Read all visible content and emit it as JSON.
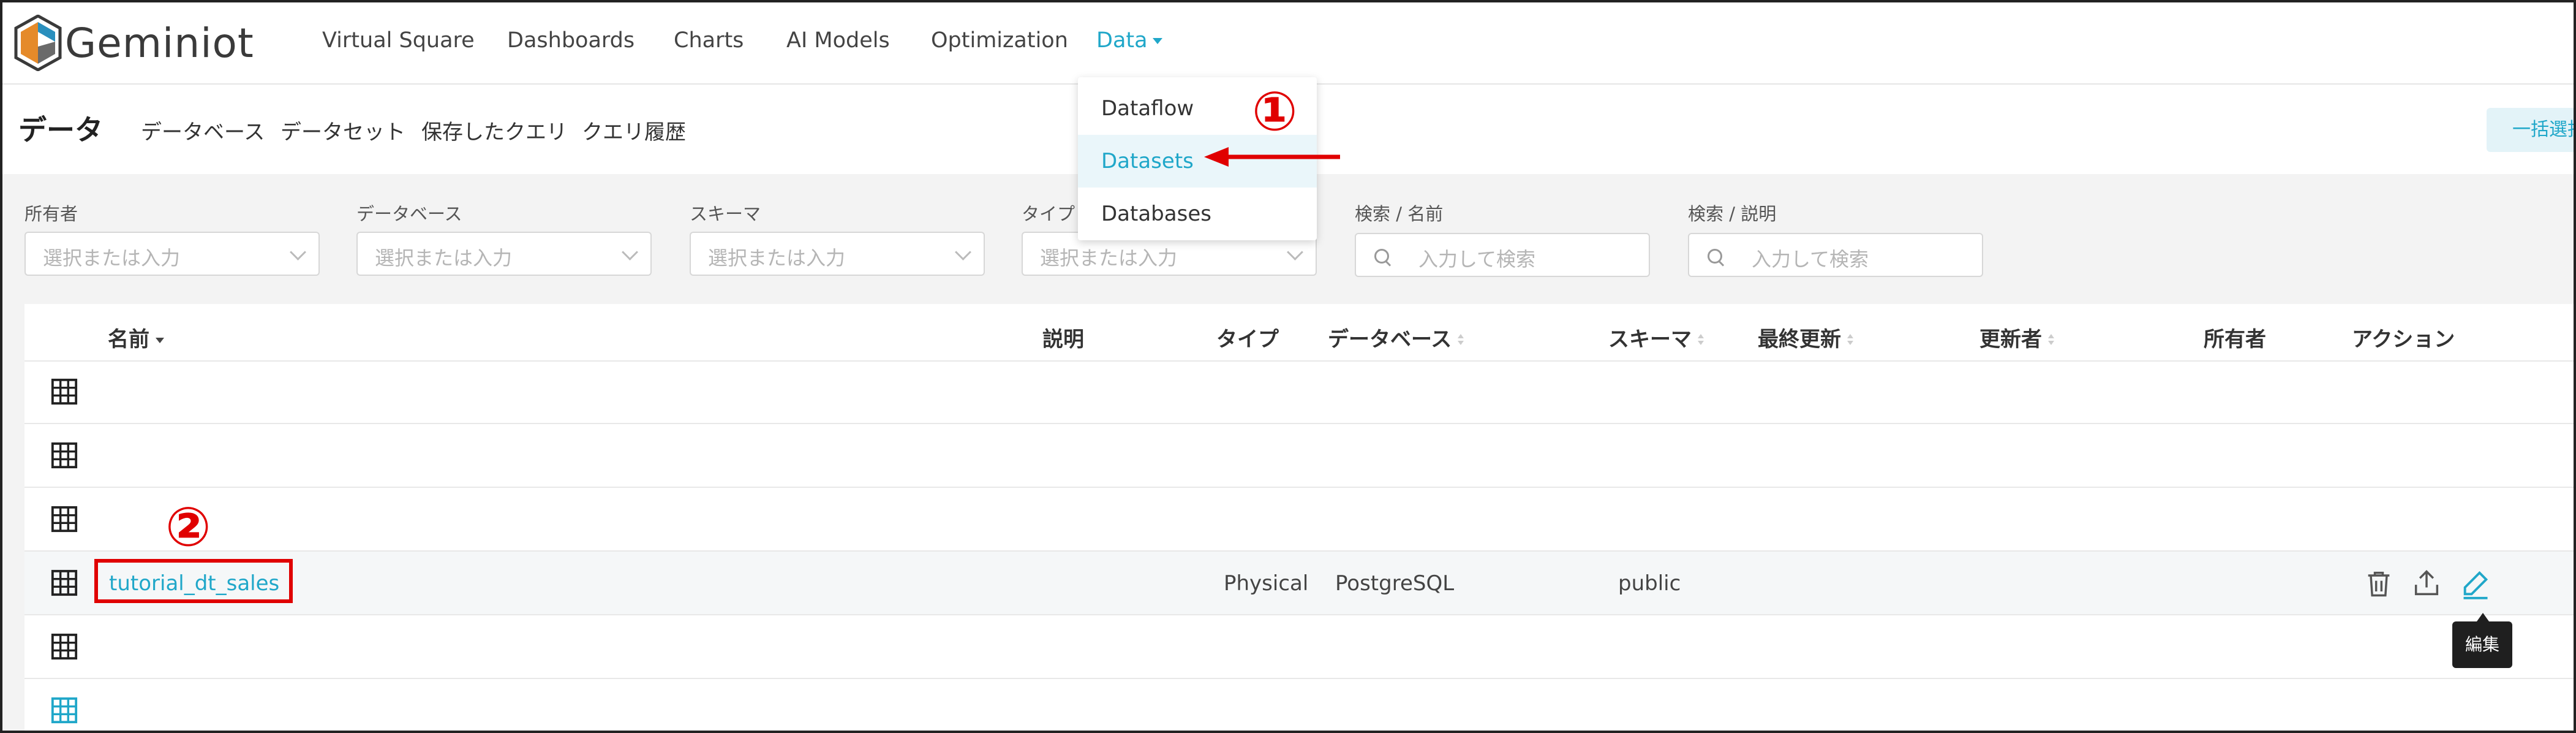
{
  "app": {
    "name": "Geminiot"
  },
  "nav": {
    "items": [
      {
        "label": "Virtual Square"
      },
      {
        "label": "Dashboards"
      },
      {
        "label": "Charts"
      },
      {
        "label": "AI Models"
      },
      {
        "label": "Optimization"
      },
      {
        "label": "Data"
      }
    ],
    "active": "Data"
  },
  "data_menu": {
    "items": [
      {
        "label": "Dataflow"
      },
      {
        "label": "Datasets"
      },
      {
        "label": "Databases"
      }
    ],
    "selected": "Datasets"
  },
  "page": {
    "title": "データ",
    "tabs": [
      {
        "label": "データベース"
      },
      {
        "label": "データセット"
      },
      {
        "label": "保存したクエリ"
      },
      {
        "label": "クエリ履歴"
      }
    ],
    "bulk_select": "一括選択"
  },
  "filters": [
    {
      "label": "所有者",
      "placeholder": "選択または入力"
    },
    {
      "label": "データベース",
      "placeholder": "選択または入力"
    },
    {
      "label": "スキーマ",
      "placeholder": "選択または入力"
    },
    {
      "label": "タイプ",
      "placeholder": "選択または入力"
    },
    {
      "label": "検索 / 名前",
      "placeholder": "入力して検索"
    },
    {
      "label": "検索 / 説明",
      "placeholder": "入力して検索"
    }
  ],
  "table": {
    "columns": [
      "名前",
      "説明",
      "タイプ",
      "データベース",
      "スキーマ",
      "最終更新",
      "更新者",
      "所有者",
      "アクション"
    ],
    "rows": [
      {
        "name": "",
        "type": "",
        "database": "",
        "schema": ""
      },
      {
        "name": "",
        "type": "",
        "database": "",
        "schema": ""
      },
      {
        "name": "",
        "type": "",
        "database": "",
        "schema": ""
      },
      {
        "name": "tutorial_dt_sales",
        "type": "Physical",
        "database": "PostgreSQL",
        "schema": "public"
      },
      {
        "name": "",
        "type": "",
        "database": "",
        "schema": ""
      },
      {
        "name": "",
        "type": "",
        "database": "",
        "schema": ""
      }
    ]
  },
  "annotations": {
    "step1": "①",
    "step2": "②",
    "tooltip": "編集"
  },
  "colors": {
    "accent": "#20a7c9",
    "annotation": "#e00000"
  }
}
